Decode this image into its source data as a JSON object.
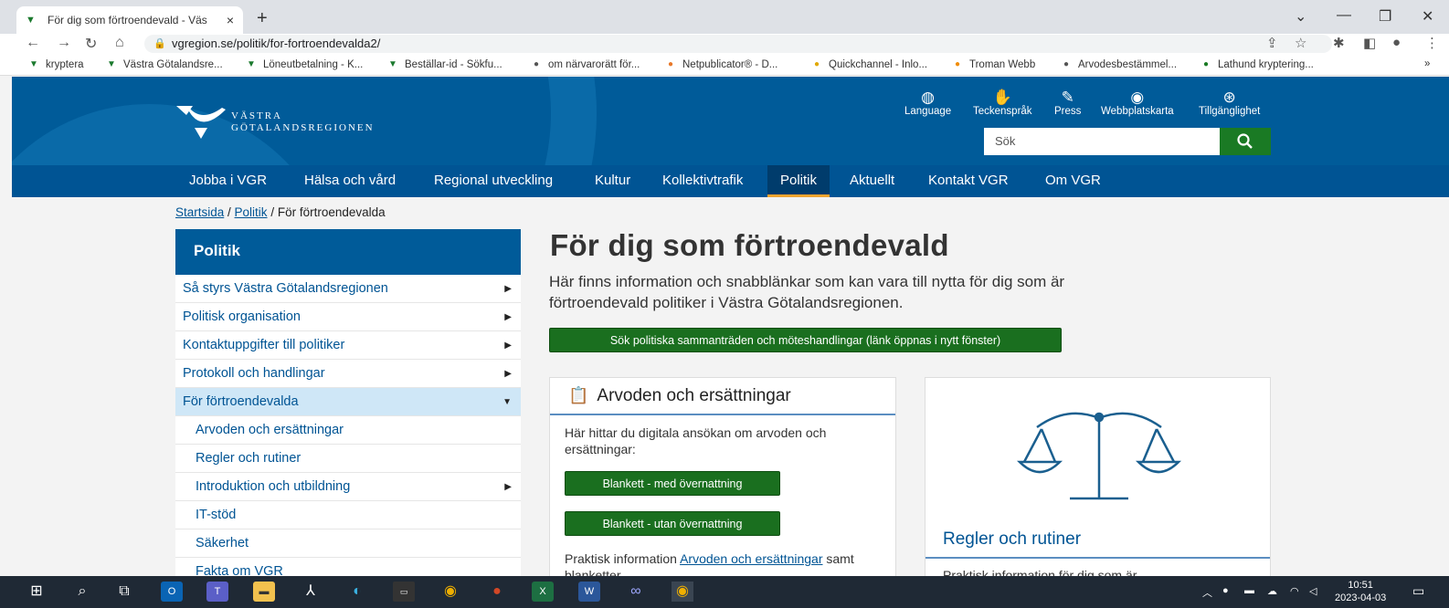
{
  "browser": {
    "tab_title": "För dig som förtroendevald - Väs",
    "tab_close": "×",
    "new_tab": "+",
    "url": "vgregion.se/politik/for-fortroendevalda2/",
    "bookmarks": [
      {
        "label": "kryptera",
        "icon": "vgr-icon"
      },
      {
        "label": "Västra Götalandsre...",
        "icon": "vgr-icon"
      },
      {
        "label": "Löneutbetalning - K...",
        "icon": "vgr-icon"
      },
      {
        "label": "Beställar-id - Sökfu...",
        "icon": "vgr-icon"
      },
      {
        "label": "om närvarorätt för...",
        "icon": "globe-icon"
      },
      {
        "label": "Netpublicator® - D...",
        "icon": "netpublicator-icon"
      },
      {
        "label": "Quickchannel - Inlo...",
        "icon": "quickchannel-icon"
      },
      {
        "label": "Troman Webb",
        "icon": "troman-icon"
      },
      {
        "label": "Arvodesbestämmel...",
        "icon": "globe-icon"
      },
      {
        "label": "Lathund kryptering...",
        "icon": "lathund-icon"
      }
    ],
    "bookmarks_more": "»"
  },
  "header": {
    "logo_line1": "VÄSTRA",
    "logo_line2": "GÖTALANDSREGIONEN",
    "tools": [
      {
        "label": "Language",
        "icon": "globe-icon"
      },
      {
        "label": "Teckenspråk",
        "icon": "sign-language-icon"
      },
      {
        "label": "Press",
        "icon": "pencil-icon"
      },
      {
        "label": "Webbplatskarta",
        "icon": "compass-icon"
      },
      {
        "label": "Tillgänglighet",
        "icon": "accessibility-icon"
      }
    ],
    "search_placeholder": "Sök"
  },
  "nav": {
    "items": [
      "Jobba i VGR",
      "Hälsa och vård",
      "Regional utveckling",
      "Kultur",
      "Kollektivtrafik",
      "Politik",
      "Aktuellt",
      "Kontakt VGR",
      "Om VGR"
    ],
    "active": "Politik"
  },
  "breadcrumb": {
    "home": "Startsida",
    "sep1": " / ",
    "parent": "Politik",
    "sep2": " / ",
    "current": "För förtroendevalda"
  },
  "sidebar": {
    "heading": "Politik",
    "items": [
      {
        "label": "Så styrs Västra Götalandsregionen",
        "sub": false,
        "arrow": "▶"
      },
      {
        "label": "Politisk organisation",
        "sub": false,
        "arrow": "▶"
      },
      {
        "label": "Kontaktuppgifter till politiker",
        "sub": false,
        "arrow": "▶"
      },
      {
        "label": "Protokoll och handlingar",
        "sub": false,
        "arrow": "▶"
      },
      {
        "label": "För förtroendevalda",
        "sub": false,
        "arrow": "▼",
        "active": true
      },
      {
        "label": "Arvoden och ersättningar",
        "sub": true,
        "arrow": ""
      },
      {
        "label": "Regler och rutiner",
        "sub": true,
        "arrow": ""
      },
      {
        "label": "Introduktion och utbildning",
        "sub": true,
        "arrow": "▶"
      },
      {
        "label": "IT-stöd",
        "sub": true,
        "arrow": ""
      },
      {
        "label": "Säkerhet",
        "sub": true,
        "arrow": ""
      },
      {
        "label": "Fakta om VGR",
        "sub": true,
        "arrow": ""
      }
    ]
  },
  "main": {
    "title": "För dig som förtroendevald",
    "lead": "Här finns information och snabblänkar som kan vara till nytta för dig som är förtroendevald politiker i Västra Götalandsregionen.",
    "cta": "Sök politiska sammanträden och möteshandlingar (länk öppnas i nytt fönster)",
    "card1": {
      "title": "Arvoden och ersättningar",
      "text": "Här hittar du digitala ansökan om arvoden och ersättningar:",
      "btn1": "Blankett - med övernattning",
      "btn2": "Blankett - utan övernattning",
      "prak_prefix": "Praktisk information ",
      "prak_link": "Arvoden och ersättningar",
      "prak_suffix": " samt blanketter"
    },
    "card2": {
      "title": "Regler och rutiner",
      "text": "Praktisk information för dig som är"
    }
  },
  "taskbar": {
    "clock_time": "10:51",
    "clock_date": "2023-04-03"
  },
  "colors": {
    "header_blue": "#005b99",
    "nav_blue": "#005494",
    "green": "#1a6f1f",
    "active_underline": "#f0a32f"
  }
}
